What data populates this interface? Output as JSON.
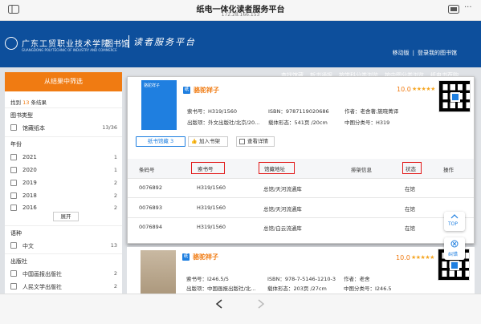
{
  "browser": {
    "title": "纸电一体化读者服务平台",
    "url": "172.28.166.153"
  },
  "header": {
    "school_name_cn": "广东工贸职业技术学院",
    "school_name_en": "GUANGDONG POLYTECHNIC OF INDUSTRY AND COMMERCE",
    "library": "图书馆",
    "slogan": "读者服务平台",
    "top_links": [
      "移动版",
      "|",
      "登录我的图书馆"
    ],
    "nav": [
      "查找馆藏",
      "新书通报",
      "按学科分类浏览",
      "按中图分类浏览",
      "纸电书荐购"
    ]
  },
  "sidebar": {
    "filter_button": "从结果中筛选",
    "found_prefix": "找到",
    "found_count": "13",
    "found_suffix": "条结果",
    "sections": {
      "type": {
        "title": "图书类型",
        "items": [
          {
            "label": "馆藏纸本",
            "count": "13/36"
          }
        ]
      },
      "year": {
        "title": "年份",
        "items": [
          {
            "label": "2021",
            "count": "1"
          },
          {
            "label": "2020",
            "count": "1"
          },
          {
            "label": "2019",
            "count": "2"
          },
          {
            "label": "2018",
            "count": "2"
          },
          {
            "label": "2016",
            "count": "2"
          }
        ]
      },
      "expand": "展开",
      "lang": {
        "title": "语种",
        "items": [
          {
            "label": "中文",
            "count": "13"
          }
        ]
      },
      "publisher": {
        "title": "出版社",
        "items": [
          {
            "label": "中国画报出版社",
            "count": "2"
          },
          {
            "label": "人民文学出版社",
            "count": "2"
          }
        ]
      }
    }
  },
  "book1": {
    "badge": "纸",
    "title": "骆驼祥子",
    "cover_title": "骆驼祥子",
    "score": "10.0",
    "stars": "★★★★★",
    "call_no": "索书号：H319/1560",
    "isbn": "ISBN：9787119020686",
    "author": "作者：老舍著;施晓菁译",
    "publisher": "出版项：外文出版社/北京/20...",
    "form": "载体形态：541页 /20cm",
    "clc": "中图分类号：H319",
    "tab_holdings": "纸书馆藏 3",
    "add_shelf": "加入书架",
    "details": "查看详情",
    "table": {
      "headers": [
        "条码号",
        "索书号",
        "馆藏地址",
        "排架信息",
        "状态",
        "操作"
      ],
      "rows": [
        [
          "0076892",
          "H319/1560",
          "总馆/天河流通库",
          "",
          "在馆",
          ""
        ],
        [
          "0076893",
          "H319/1560",
          "总馆/天河流通库",
          "",
          "在馆",
          ""
        ],
        [
          "0076894",
          "H319/1560",
          "总馆/白云流通库",
          "",
          "在馆",
          ""
        ]
      ]
    }
  },
  "book2": {
    "badge": "纸",
    "title": "骆驼祥子",
    "score": "10.0",
    "stars": "★★★★★",
    "call_no": "索书号：I246.5/5",
    "isbn": "ISBN：978-7-5146-1210-3",
    "author": "作者：老舍",
    "publisher": "出版项：中国画报出版社/北...",
    "form": "载体形态：203页 /27cm",
    "clc": "中图分类号：I246.5"
  },
  "float": {
    "top": "TOP",
    "error": "纠错"
  },
  "colors": {
    "header_blue": "#0d4f9c",
    "accent_orange": "#f07b12",
    "link_blue": "#1f7fe0",
    "highlight_red": "#e21b1b"
  }
}
